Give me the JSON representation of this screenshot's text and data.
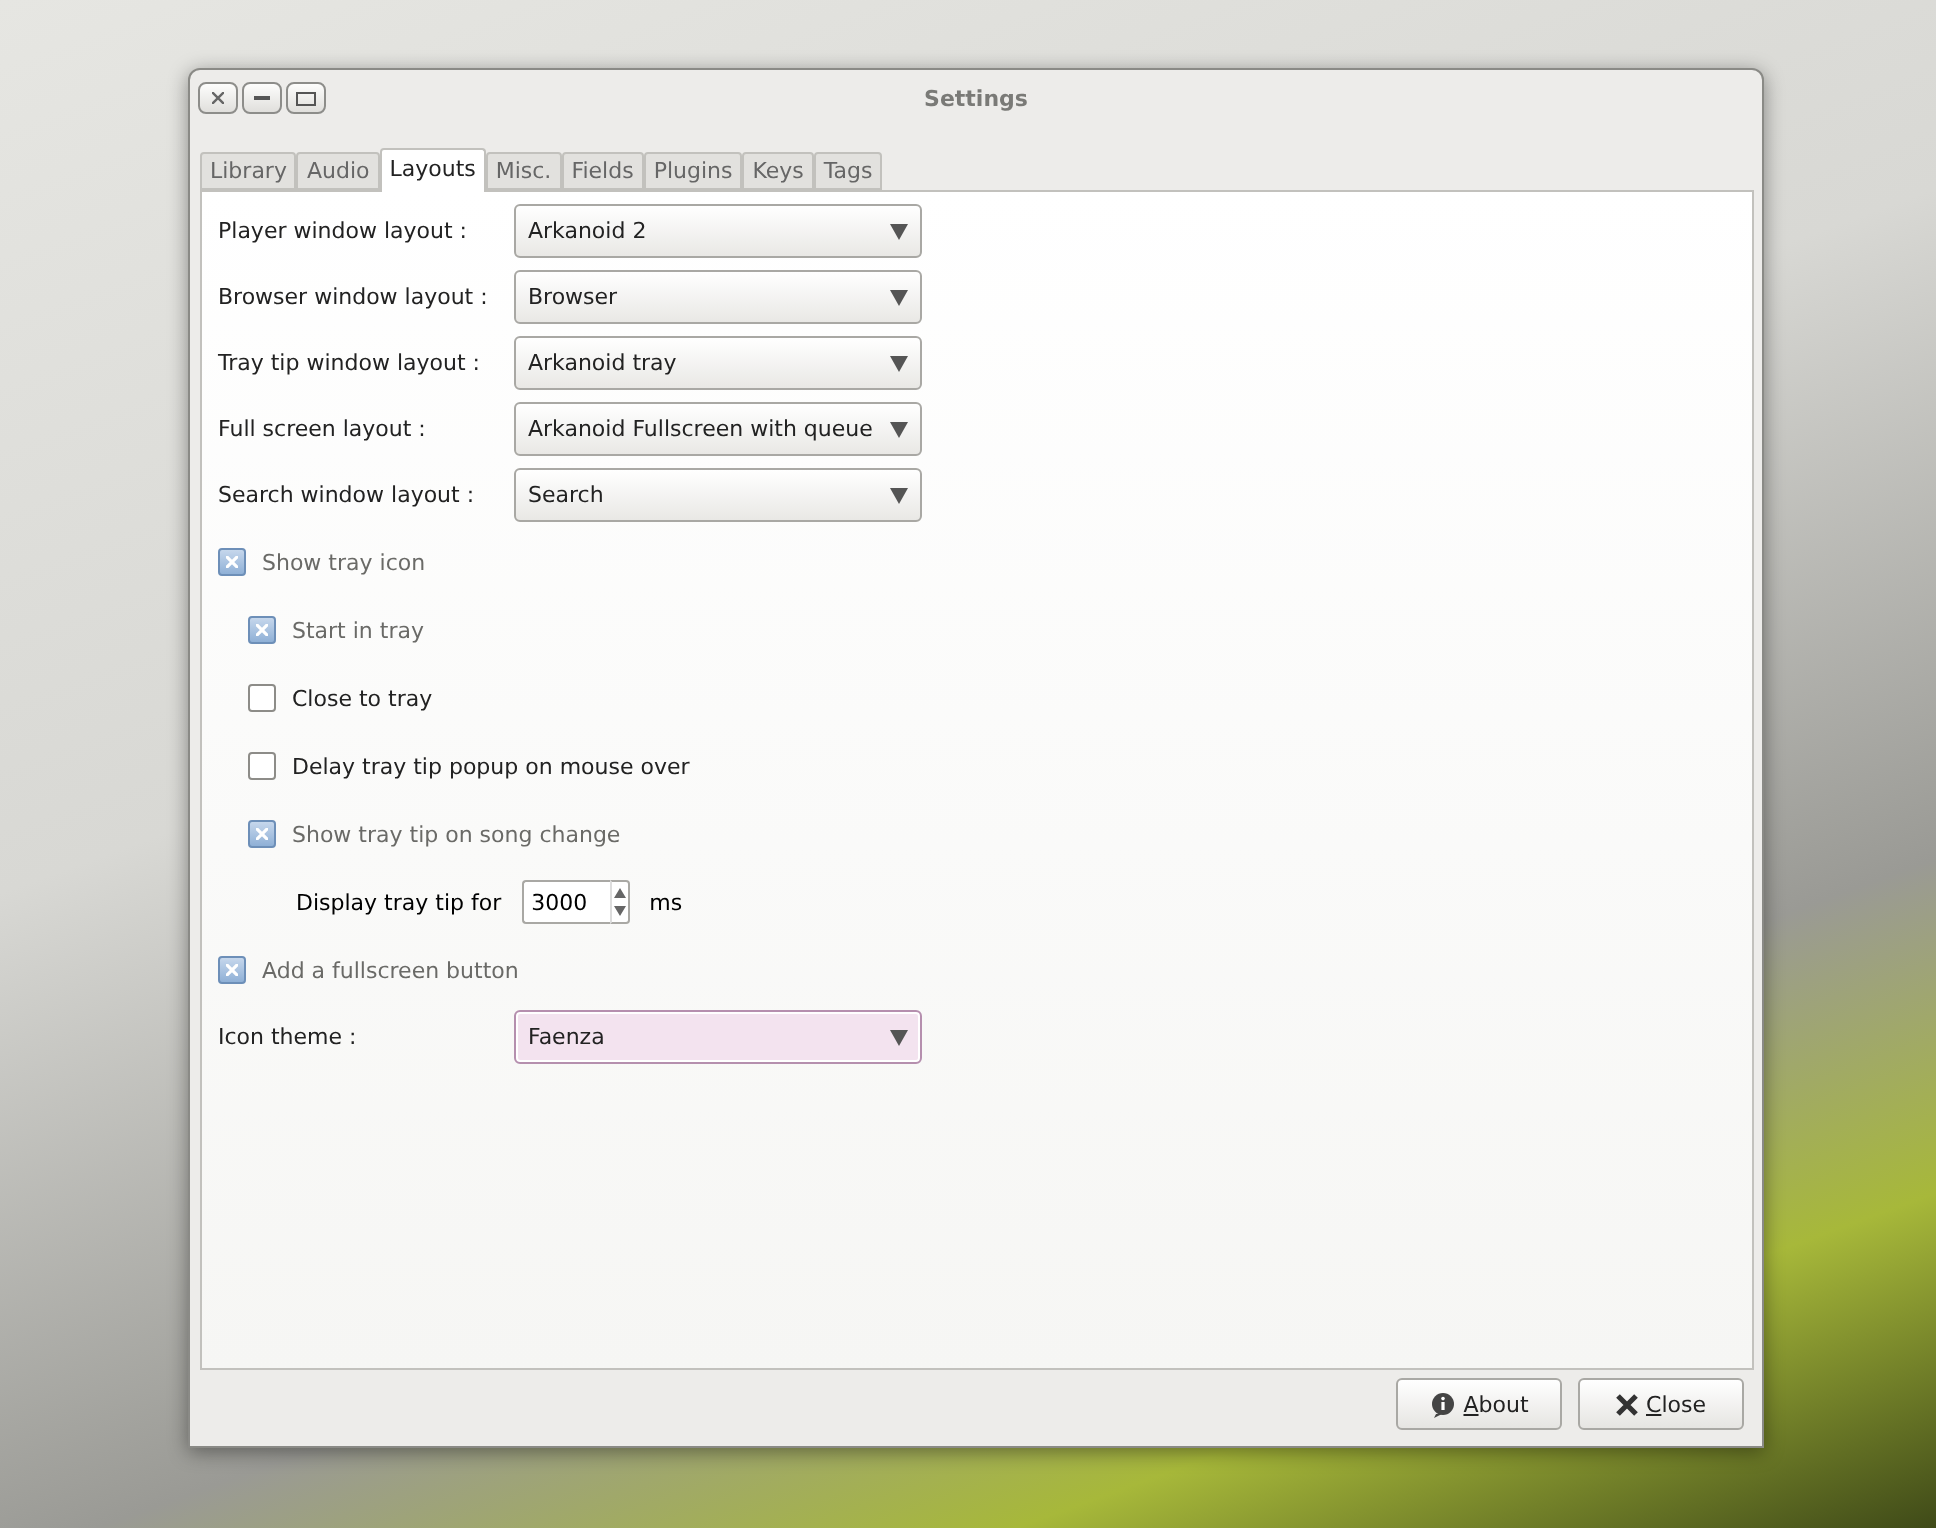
{
  "window": {
    "title": "Settings"
  },
  "tabs": [
    {
      "label": "Library",
      "selected": false
    },
    {
      "label": "Audio",
      "selected": false
    },
    {
      "label": "Layouts",
      "selected": true
    },
    {
      "label": "Misc.",
      "selected": false
    },
    {
      "label": "Fields",
      "selected": false
    },
    {
      "label": "Plugins",
      "selected": false
    },
    {
      "label": "Keys",
      "selected": false
    },
    {
      "label": "Tags",
      "selected": false
    }
  ],
  "layouts": [
    {
      "label": "Player window layout :",
      "value": "Arkanoid 2",
      "focused": false
    },
    {
      "label": "Browser window layout :",
      "value": "Browser",
      "focused": false
    },
    {
      "label": "Tray tip window layout :",
      "value": "Arkanoid tray",
      "focused": false
    },
    {
      "label": "Full screen layout :",
      "value": "Arkanoid Fullscreen with queue",
      "focused": false
    },
    {
      "label": "Search window layout :",
      "value": "Search",
      "focused": false
    }
  ],
  "options": [
    {
      "kind": "checkbox",
      "label": "Show tray icon",
      "checked": true,
      "children": [
        {
          "kind": "checkbox",
          "label": "Start in tray",
          "checked": true
        },
        {
          "kind": "checkbox",
          "label": "Close to tray",
          "checked": false
        },
        {
          "kind": "checkbox",
          "label": "Delay tray tip popup on mouse over",
          "checked": false
        },
        {
          "kind": "checkbox",
          "label": "Show tray tip on song change",
          "checked": true,
          "children": [
            {
              "kind": "spin",
              "label": "Display tray tip for",
              "value": "3000",
              "unit": "ms"
            }
          ]
        }
      ]
    },
    {
      "kind": "checkbox",
      "label": "Add a fullscreen button",
      "checked": true
    }
  ],
  "icon_theme": {
    "label": "Icon theme :",
    "value": "Faenza",
    "focused": true
  },
  "buttons": [
    {
      "kind": "info",
      "label": "About"
    },
    {
      "kind": "close",
      "label": "Close"
    }
  ]
}
